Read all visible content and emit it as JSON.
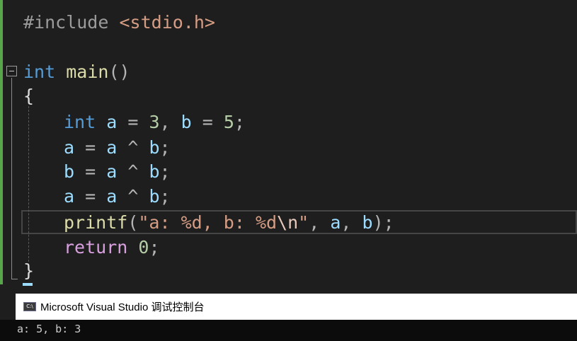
{
  "editor": {
    "lines": {
      "include": {
        "directive": "#include",
        "header": "<stdio.h>"
      },
      "main_decl": {
        "type": "int",
        "name": "main",
        "parens": "()"
      },
      "open_brace": "{",
      "decl": {
        "type": "int",
        "var_a": "a",
        "eq1": " = ",
        "val_a": "3",
        "comma": ", ",
        "var_b": "b",
        "eq2": " = ",
        "val_b": "5",
        "semi": ";"
      },
      "xor1": {
        "lhs": "a",
        "eq": " = ",
        "op1": "a",
        "xor": " ^ ",
        "op2": "b",
        "semi": ";"
      },
      "xor2": {
        "lhs": "b",
        "eq": " = ",
        "op1": "a",
        "xor": " ^ ",
        "op2": "b",
        "semi": ";"
      },
      "xor3": {
        "lhs": "a",
        "eq": " = ",
        "op1": "a",
        "xor": " ^ ",
        "op2": "b",
        "semi": ";"
      },
      "printf": {
        "fn": "printf",
        "open": "(",
        "str_start": "\"a: %d, b: %d",
        "esc": "\\n",
        "str_end": "\"",
        "sep1": ", ",
        "arg1": "a",
        "sep2": ", ",
        "arg2": "b",
        "close": ");"
      },
      "ret": {
        "kw": "return",
        "val": "0",
        "semi": ";"
      },
      "close_brace": "}"
    }
  },
  "console": {
    "icon_text": "C:\\",
    "title": "Microsoft Visual Studio 调试控制台",
    "output": "a: 5, b: 3"
  },
  "colors": {
    "keyword": "#569cd6",
    "control_keyword": "#d8a0df",
    "function": "#dcdcaa",
    "variable": "#9cdcfe",
    "number": "#b5cea8",
    "string": "#d69d85",
    "preprocessor": "#9b9b9b",
    "change_bar": "#57a64a"
  }
}
